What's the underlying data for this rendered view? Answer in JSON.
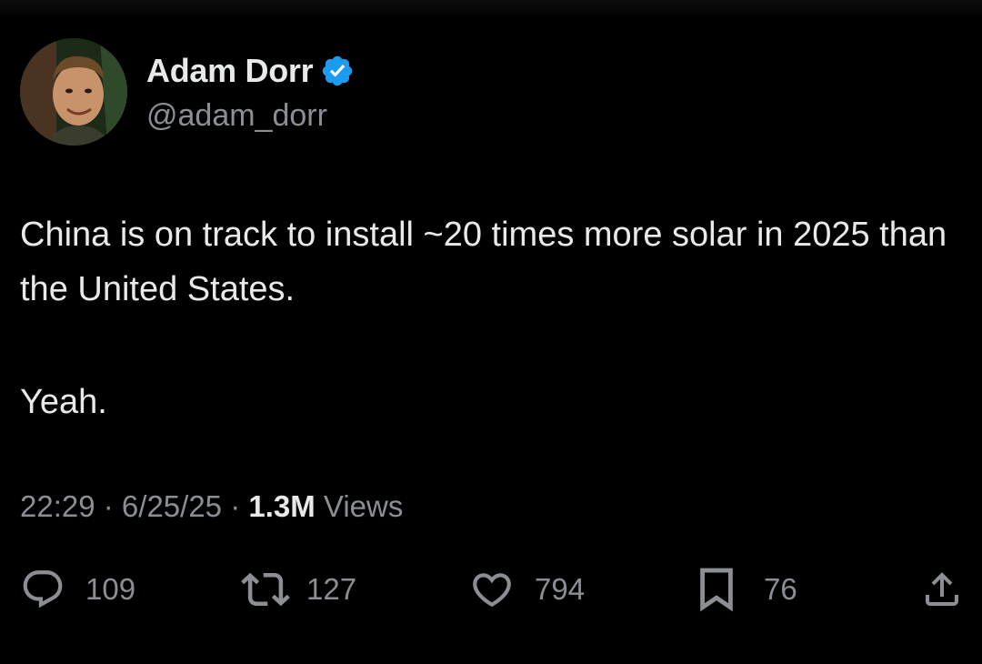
{
  "author": {
    "display_name": "Adam Dorr",
    "handle": "@adam_dorr",
    "verified": true
  },
  "tweet": {
    "paragraphs": [
      "China is on track to install ~20 times more solar in 2025 than the United States.",
      "Yeah."
    ]
  },
  "meta": {
    "time": "22:29",
    "separator": " · ",
    "date": "6/25/25",
    "views_count": "1.3M",
    "views_label": " Views"
  },
  "actions": {
    "replies": "109",
    "reposts": "127",
    "likes": "794",
    "bookmarks": "76"
  },
  "icons": {
    "reply": "speech-bubble-icon",
    "repost": "repost-arrows-icon",
    "like": "heart-icon",
    "bookmark": "bookmark-icon",
    "share": "share-upload-icon",
    "verified": "verified-badge-icon"
  },
  "colors": {
    "background": "#000000",
    "primary_text": "#e7e9ea",
    "secondary_text": "#8b8f94",
    "verified_blue": "#1d9bf0"
  }
}
